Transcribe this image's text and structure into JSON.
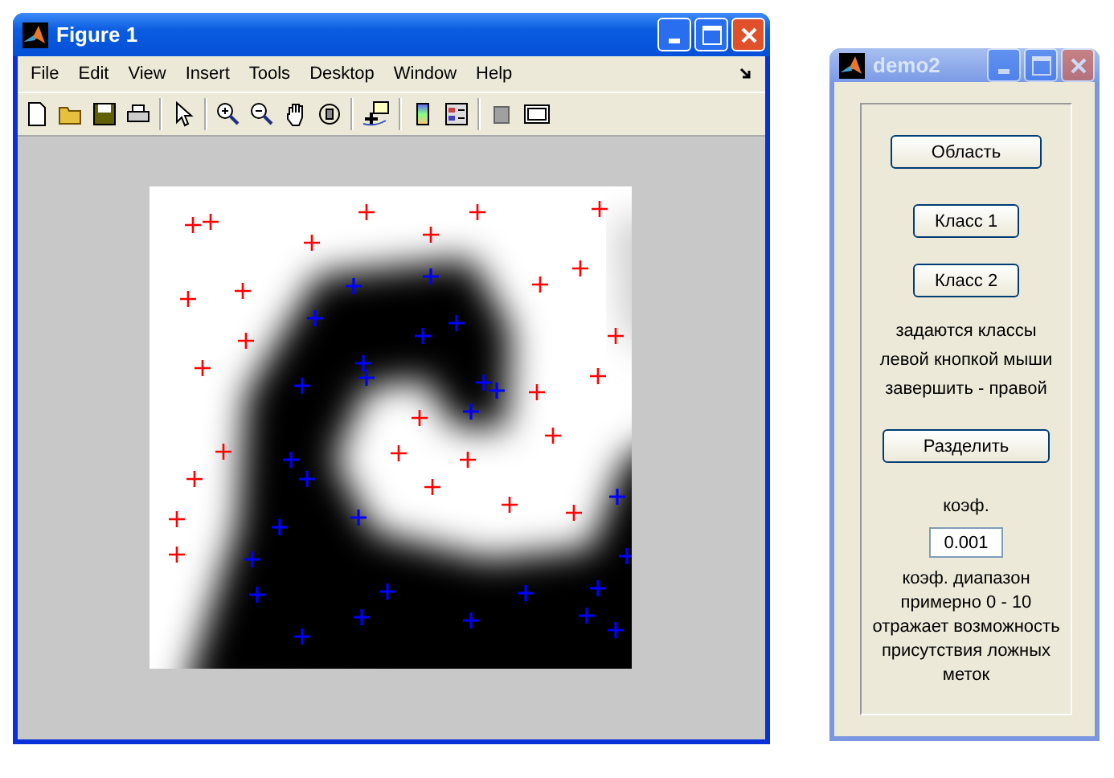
{
  "figure_window": {
    "title": "Figure 1",
    "active": true,
    "menu": [
      "File",
      "Edit",
      "View",
      "Insert",
      "Tools",
      "Desktop",
      "Window",
      "Help"
    ]
  },
  "demo_window": {
    "title": "demo2",
    "active": false,
    "controls": [
      {
        "kind": "button",
        "label": "Область",
        "wide": true
      },
      {
        "kind": "button",
        "label": "Класс 1",
        "wide": false
      },
      {
        "kind": "button",
        "label": "Класс 2",
        "wide": false
      },
      {
        "kind": "text",
        "lines": [
          "задаются классы",
          "левой кнопкой мыши",
          "завершить - правой"
        ]
      },
      {
        "kind": "button",
        "label": "Разделить",
        "wide": true
      },
      {
        "kind": "text",
        "lines": [
          "коэф."
        ]
      },
      {
        "kind": "input",
        "value": "0.001"
      },
      {
        "kind": "text",
        "lines": [
          "коэф. диапазон",
          "примерно 0 - 10",
          "отражает возможность",
          "присутствия ложных",
          "меток"
        ]
      }
    ]
  }
}
